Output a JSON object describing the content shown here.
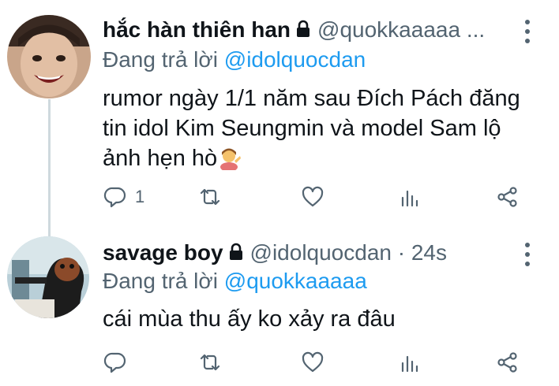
{
  "tweets": [
    {
      "name": "hắc hàn thiên han",
      "handle": "@quokkaaaaa ...",
      "replying_label": "Đang trả lời",
      "replying_to": "@idolquocdan",
      "text": "rumor ngày 1/1 năm sau Đích Pách đăng tin idol Kim Seungmin và model Sam lộ ảnh hẹn hò",
      "emoji": "person-tipping-hand-emoji",
      "reply_count": "1"
    },
    {
      "name": "savage boy",
      "handle": "@idolquocdan · 24s",
      "replying_label": "Đang trả lời",
      "replying_to": "@quokkaaaaa",
      "text": "cái mùa thu ấy ko xảy ra đâu",
      "reply_count": ""
    }
  ],
  "icons": [
    "lock-icon",
    "more-icon",
    "reply-icon",
    "retweet-icon",
    "like-icon",
    "views-icon",
    "share-icon"
  ],
  "colors": {
    "link": "#1d9bf0",
    "secondary": "#536471",
    "thread_line": "#cfd9de"
  }
}
